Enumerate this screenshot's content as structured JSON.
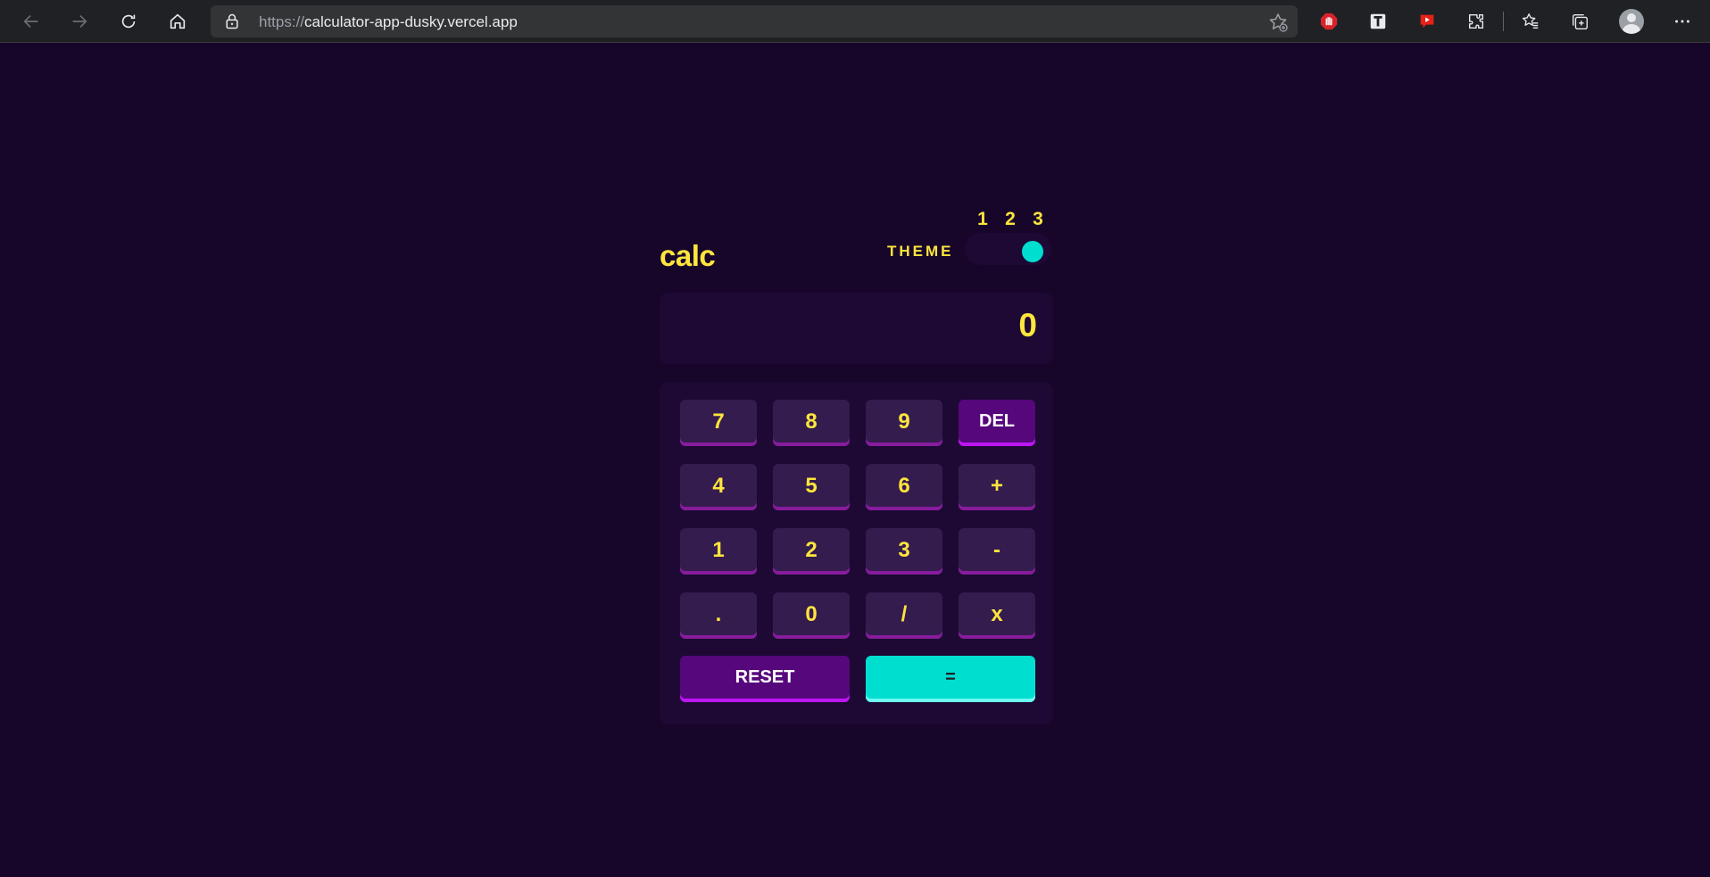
{
  "browser": {
    "url_protocol": "https://",
    "url_host": "calculator-app-dusky.vercel.app"
  },
  "calculator": {
    "logo": "calc",
    "theme_label": "THEME",
    "theme_options": [
      "1",
      "2",
      "3"
    ],
    "theme_selected": 3,
    "display_value": "0",
    "keys": {
      "k7": "7",
      "k8": "8",
      "k9": "9",
      "del": "DEL",
      "k4": "4",
      "k5": "5",
      "k6": "6",
      "plus": "+",
      "k1": "1",
      "k2": "2",
      "k3": "3",
      "minus": "-",
      "dot": ".",
      "k0": "0",
      "divide": "/",
      "times": "x",
      "reset": "RESET",
      "equals": "="
    }
  },
  "colors": {
    "background": "#17062a",
    "panel": "#1d0934",
    "accent_text": "#ffe53d",
    "key": "#341c4f",
    "key_shadow": "#871c9c",
    "function_key": "#56077c",
    "equals_key": "#00ded0"
  }
}
